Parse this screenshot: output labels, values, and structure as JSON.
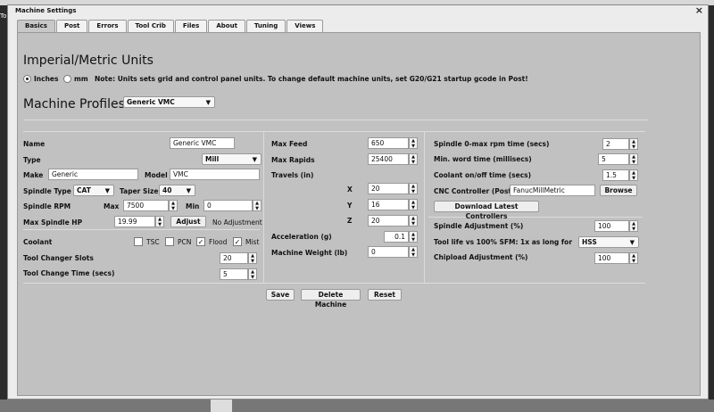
{
  "window": {
    "title": "Machine Settings",
    "close_label": "×"
  },
  "background": {
    "toolbar_text": "To"
  },
  "tabs": [
    "Basics",
    "Post",
    "Errors",
    "Tool Crib",
    "Files",
    "About",
    "Tuning",
    "Views"
  ],
  "units": {
    "heading": "Imperial/Metric Units",
    "inches_label": "Inches",
    "mm_label": "mm",
    "note": "Note: Units sets grid and control panel units. To change default machine units, set G20/G21 startup gcode in Post!"
  },
  "profiles": {
    "heading": "Machine Profiles",
    "selected": "Generic VMC"
  },
  "left": {
    "name_label": "Name",
    "name_value": "Generic VMC",
    "type_label": "Type",
    "type_value": "Mill",
    "make_label": "Make",
    "make_value": "Generic",
    "model_label": "Model",
    "model_value": "VMC",
    "spindle_type_label": "Spindle Type",
    "spindle_type_value": "CAT",
    "taper_label": "Taper Size",
    "taper_value": "40",
    "rpm_label": "Spindle RPM",
    "max_label": "Max",
    "max_value": "7500",
    "min_label": "Min",
    "min_value": "0",
    "hp_label": "Max Spindle HP",
    "hp_value": "19.99",
    "adjust_label": "Adjust",
    "no_adjust": "No Adjustment",
    "coolant_label": "Coolant",
    "tsc_label": "TSC",
    "pcn_label": "PCN",
    "flood_label": "Flood",
    "mist_label": "Mist",
    "slots_label": "Tool Changer Slots",
    "slots_value": "20",
    "change_time_label": "Tool Change Time (secs)",
    "change_time_value": "5"
  },
  "middle": {
    "max_feed_label": "Max Feed",
    "max_feed_value": "650",
    "max_rapids_label": "Max Rapids",
    "max_rapids_value": "25400",
    "travels_label": "Travels (in)",
    "x_label": "X",
    "x_value": "20",
    "y_label": "Y",
    "y_value": "16",
    "z_label": "Z",
    "z_value": "20",
    "accel_label": "Acceleration (g)",
    "accel_value": "0.1",
    "weight_label": "Machine Weight (lb)",
    "weight_value": "0"
  },
  "right": {
    "spindle_time_label": "Spindle 0-max rpm time (secs)",
    "spindle_time_value": "2",
    "word_time_label": "Min. word time (millisecs)",
    "word_time_value": "5",
    "coolant_time_label": "Coolant on/off time (secs)",
    "coolant_time_value": "1.5",
    "cnc_label": "CNC Controller (Post)",
    "cnc_value": "FanucMillMetric",
    "browse_label": "Browse",
    "download_label": "Download Latest Controllers",
    "spindle_adj_label": "Spindle Adjustment (%)",
    "spindle_adj_value": "100",
    "tool_life_label": "Tool life vs 100% SFM: 1x as long for",
    "tool_life_value": "HSS",
    "chipload_label": "Chipload Adjustment (%)",
    "chipload_value": "100"
  },
  "buttons": {
    "save": "Save",
    "delete": "Delete Machine",
    "reset": "Reset"
  },
  "icons": {
    "arrow": "▼",
    "spin_up": "▲",
    "spin_down": "▼",
    "check": "✓"
  }
}
